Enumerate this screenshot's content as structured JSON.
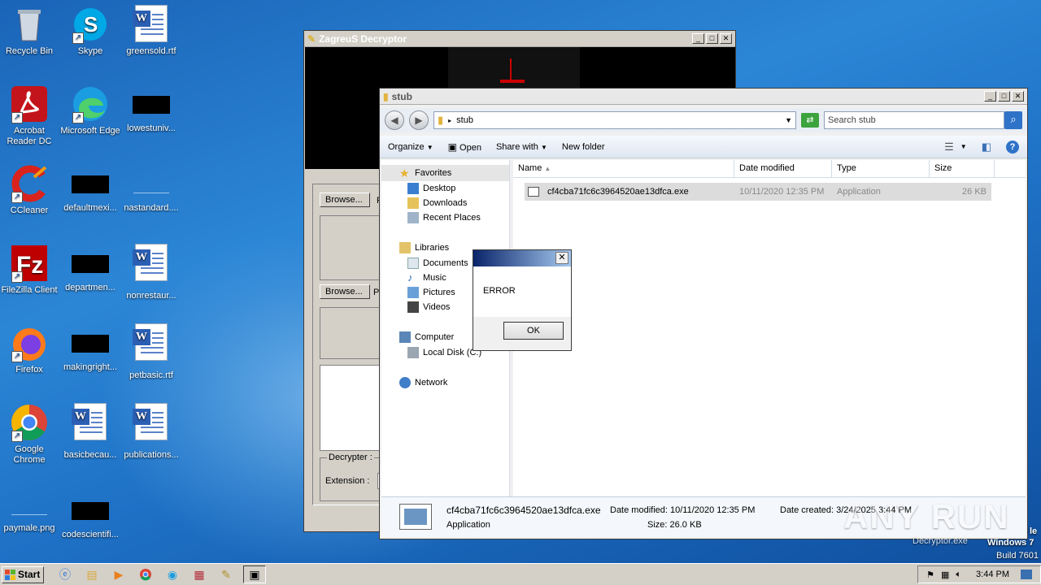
{
  "desktop_icons": [
    {
      "label": "Recycle Bin",
      "icon": "recycle-bin-icon"
    },
    {
      "label": "Skype",
      "icon": "skype-icon"
    },
    {
      "label": "greensold.rtf",
      "icon": "word-document-icon"
    },
    {
      "label": "Acrobat Reader DC",
      "icon": "acrobat-icon"
    },
    {
      "label": "Microsoft Edge",
      "icon": "edge-icon"
    },
    {
      "label": "lowestuniv...",
      "icon": "black-thumbnail-icon"
    },
    {
      "label": "CCleaner",
      "icon": "ccleaner-icon"
    },
    {
      "label": "defaultmexi...",
      "icon": "black-thumbnail-icon"
    },
    {
      "label": "nastandard....",
      "icon": "blank-thumbnail-icon"
    },
    {
      "label": "FileZilla Client",
      "icon": "filezilla-icon"
    },
    {
      "label": "departmen...",
      "icon": "black-thumbnail-icon"
    },
    {
      "label": "nonrestaur...",
      "icon": "word-document-icon"
    },
    {
      "label": "Firefox",
      "icon": "firefox-icon"
    },
    {
      "label": "makingright...",
      "icon": "black-thumbnail-icon"
    },
    {
      "label": "petbasic.rtf",
      "icon": "word-document-icon"
    },
    {
      "label": "Google Chrome",
      "icon": "chrome-icon"
    },
    {
      "label": "basicbecau...",
      "icon": "word-document-icon"
    },
    {
      "label": "publications...",
      "icon": "word-document-icon"
    },
    {
      "label": "paymale.png",
      "icon": "blank-thumbnail-icon"
    },
    {
      "label": "codescientifi...",
      "icon": "black-thumbnail-icon"
    }
  ],
  "zagreus": {
    "title": "ZagreuS Decryptor",
    "browse1": "Browse...",
    "browse1_suffix": "F",
    "browse2": "Browse...",
    "browse2_suffix": "P",
    "decrypter_group": "Decrypter :",
    "extension_label": "Extension :"
  },
  "explorer": {
    "title": "stub",
    "address": "stub",
    "search_placeholder": "Search stub",
    "toolbar": {
      "organize": "Organize",
      "open": "Open",
      "share_with": "Share with",
      "new_folder": "New folder"
    },
    "nav": {
      "favorites": "Favorites",
      "favorites_items": [
        "Desktop",
        "Downloads",
        "Recent Places"
      ],
      "libraries": "Libraries",
      "libraries_items": [
        "Documents",
        "Music",
        "Pictures",
        "Videos"
      ],
      "computer": "Computer",
      "computer_items": [
        "Local Disk (C:)"
      ],
      "network": "Network"
    },
    "columns": [
      "Name",
      "Date modified",
      "Type",
      "Size"
    ],
    "files": [
      {
        "name": "cf4cba71fc6c3964520ae13dfca.exe",
        "date": "10/11/2020 12:35 PM",
        "type": "Application",
        "size": "26 KB"
      }
    ],
    "details": {
      "name": "cf4cba71fc6c3964520ae13dfca.exe",
      "type": "Application",
      "date_modified": "Date modified: 10/11/2020 12:35 PM",
      "size": "Size: 26.0 KB",
      "date_created": "Date created: 3/24/2025 3:44 PM"
    }
  },
  "dialog": {
    "message": "ERROR",
    "ok": "OK"
  },
  "taskbar": {
    "start": "Start",
    "time": "3:44 PM"
  },
  "watermark": {
    "brand": "ANY RUN",
    "decryptor_label": "Decryptor.exe",
    "os": "Windows 7",
    "build": "Build 7601",
    "partial": "le"
  },
  "colors": {
    "desktop": "#1d6fc4",
    "dialog_title": "#0a246a",
    "selected_row": "#dcdcdc"
  }
}
